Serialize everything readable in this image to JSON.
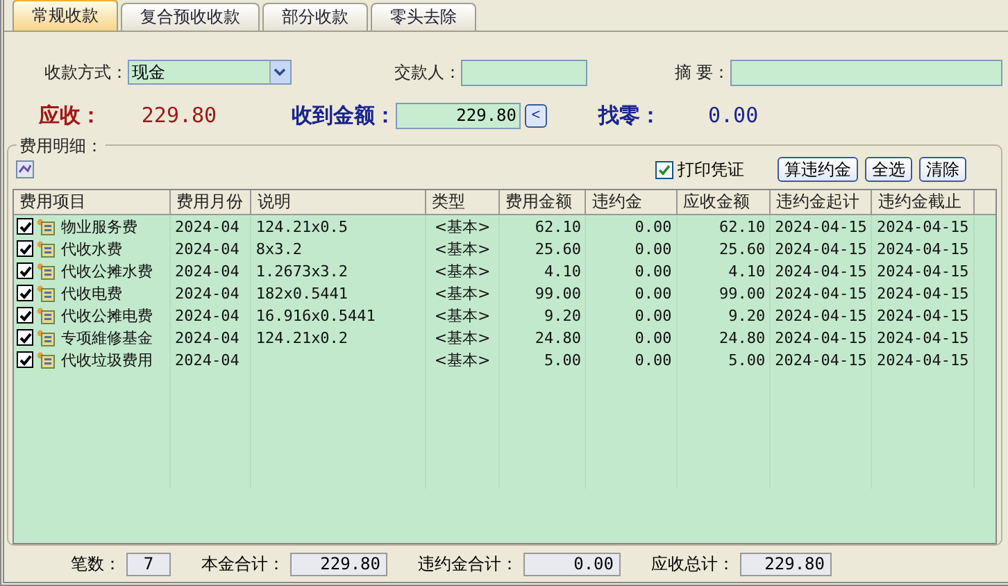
{
  "tabs": [
    {
      "label": "常规收款",
      "selected": true
    },
    {
      "label": "复合预收收款",
      "selected": false
    },
    {
      "label": "部分收款",
      "selected": false
    },
    {
      "label": "零头去除",
      "selected": false
    }
  ],
  "form": {
    "payment_method_label": "收款方式：",
    "payment_method": "现金",
    "payer_label": "交款人：",
    "summary_label": "摘 要：",
    "receivable_label": "应收：",
    "receivable": "229.80",
    "received_label": "收到金额：",
    "received": "229.80",
    "received_button": "<",
    "change_label": "找零：",
    "change": "0.00"
  },
  "details": {
    "title": "费用明细：",
    "print_voucher": {
      "label": "打印凭证",
      "checked": true
    },
    "buttons": [
      "算违约金",
      "全选",
      "清除"
    ],
    "columns": [
      "费用项目",
      "费用月份",
      "说明",
      "类型",
      "费用金额",
      "违约金",
      "应收金额",
      "违约金起计",
      "违约金截止"
    ],
    "rows": [
      {
        "checked": true,
        "cells": [
          "物业服务费",
          "2024-04",
          "124.21x0.5",
          "<基本>",
          "62.10",
          "0.00",
          "62.10",
          "2024-04-15",
          "2024-04-15"
        ]
      },
      {
        "checked": true,
        "cells": [
          "代收水费",
          "2024-04",
          "8x3.2",
          "<基本>",
          "25.60",
          "0.00",
          "25.60",
          "2024-04-15",
          "2024-04-15"
        ]
      },
      {
        "checked": true,
        "cells": [
          "代收公摊水费",
          "2024-04",
          "1.2673x3.2",
          "<基本>",
          "4.10",
          "0.00",
          "4.10",
          "2024-04-15",
          "2024-04-15"
        ]
      },
      {
        "checked": true,
        "cells": [
          "代收电费",
          "2024-04",
          "182x0.5441",
          "<基本>",
          "99.00",
          "0.00",
          "99.00",
          "2024-04-15",
          "2024-04-15"
        ]
      },
      {
        "checked": true,
        "cells": [
          "代收公摊电费",
          "2024-04",
          "16.916x0.5441",
          "<基本>",
          "9.20",
          "0.00",
          "9.20",
          "2024-04-15",
          "2024-04-15"
        ]
      },
      {
        "checked": true,
        "cells": [
          "专项維修基金",
          "2024-04",
          "124.21x0.2",
          "<基本>",
          "24.80",
          "0.00",
          "24.80",
          "2024-04-15",
          "2024-04-15"
        ]
      },
      {
        "checked": true,
        "cells": [
          "代收垃圾费用",
          "2024-04",
          "",
          "<基本>",
          "5.00",
          "0.00",
          "5.00",
          "2024-04-15",
          "2024-04-15"
        ]
      }
    ]
  },
  "totals": [
    {
      "label": "笔数：",
      "value": "7"
    },
    {
      "label": "本金合计：",
      "value": "229.80"
    },
    {
      "label": "违约金合计：",
      "value": "0.00"
    },
    {
      "label": "应收总计：",
      "value": "229.80"
    }
  ]
}
